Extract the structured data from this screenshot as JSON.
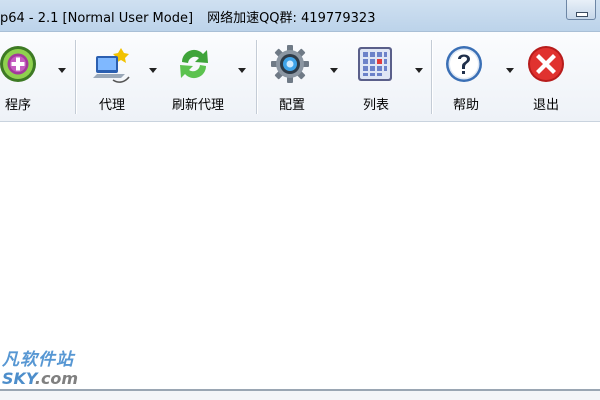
{
  "window": {
    "title": "p64 - 2.1 [Normal User Mode]",
    "title_extra": "网络加速QQ群: 419779323"
  },
  "toolbar": {
    "items": [
      {
        "label": "程序",
        "icon": "plus-circle-icon"
      },
      {
        "label": "代理",
        "icon": "monitor-network-icon"
      },
      {
        "label": "刷新代理",
        "icon": "refresh-arrows-icon"
      },
      {
        "label": "配置",
        "icon": "gear-icon"
      },
      {
        "label": "列表",
        "icon": "grid-list-icon"
      },
      {
        "label": "帮助",
        "icon": "help-question-icon"
      },
      {
        "label": "退出",
        "icon": "close-x-icon"
      }
    ]
  },
  "watermark": {
    "line1": "凡软件站",
    "line2_main": "SKY",
    "line2_suffix": ".com"
  },
  "colors": {
    "titlebar": "#c4d8ee",
    "toolbar": "#f4f7fb",
    "exit_red": "#d9262b",
    "refresh_green": "#3fa43a",
    "help_blue": "#3a6fb5",
    "watermark_blue": "#3a86cc"
  }
}
